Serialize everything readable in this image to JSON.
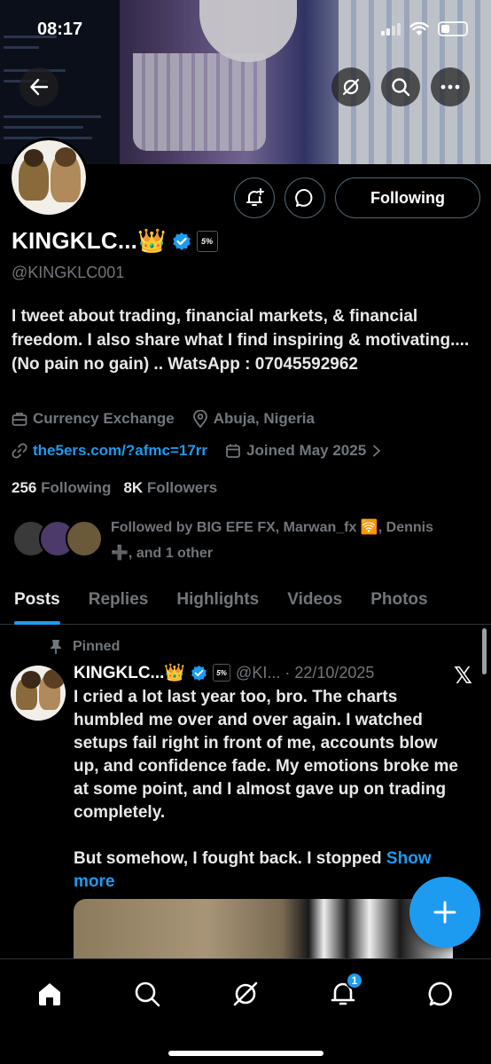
{
  "status_bar": {
    "time": "08:17"
  },
  "profile": {
    "display_name": "KINGKLC...👑",
    "handle": "@KINGKLC001",
    "affiliate_badge": "5%",
    "following_button": "Following",
    "bio": "I tweet about trading, financial markets, & financial freedom. I also share what I find inspiring & motivating.... (No pain no gain) .. WatsApp : 07045592962",
    "category": "Currency Exchange",
    "location": "Abuja, Nigeria",
    "website": "the5ers.com/?afmc=17rr",
    "joined": "Joined May 2025",
    "following_count": "256",
    "following_label": "Following",
    "followers_count": "8K",
    "followers_label": "Followers",
    "followed_by_line1": "Followed by BIG EFE FX, Marwan_fx 🛜, Dennis",
    "followed_by_line2": "➕, and 1 other"
  },
  "tabs": [
    "Posts",
    "Replies",
    "Highlights",
    "Videos",
    "Photos"
  ],
  "post": {
    "pinned_label": "Pinned",
    "name": "KINGKLC...👑",
    "handle_date": "@KI... · 22/10/2025",
    "text": "I cried a lot last year too, bro. The charts humbled me over and over again. I watched setups fail right in front of me, accounts blow up, and confidence fade. My emotions broke me at some point, and I almost gave up on trading completely.\n\nBut somehow, I fought back. I stopped ",
    "show_more": "Show more"
  },
  "bottom_nav": {
    "items": [
      "home-icon",
      "search-icon",
      "grok-icon",
      "notifications-icon",
      "messages-icon"
    ],
    "notification_count": "1"
  },
  "colors": {
    "accent": "#1d9bf0",
    "background": "#000000",
    "muted": "#71767b",
    "text": "#e7e9ea"
  }
}
